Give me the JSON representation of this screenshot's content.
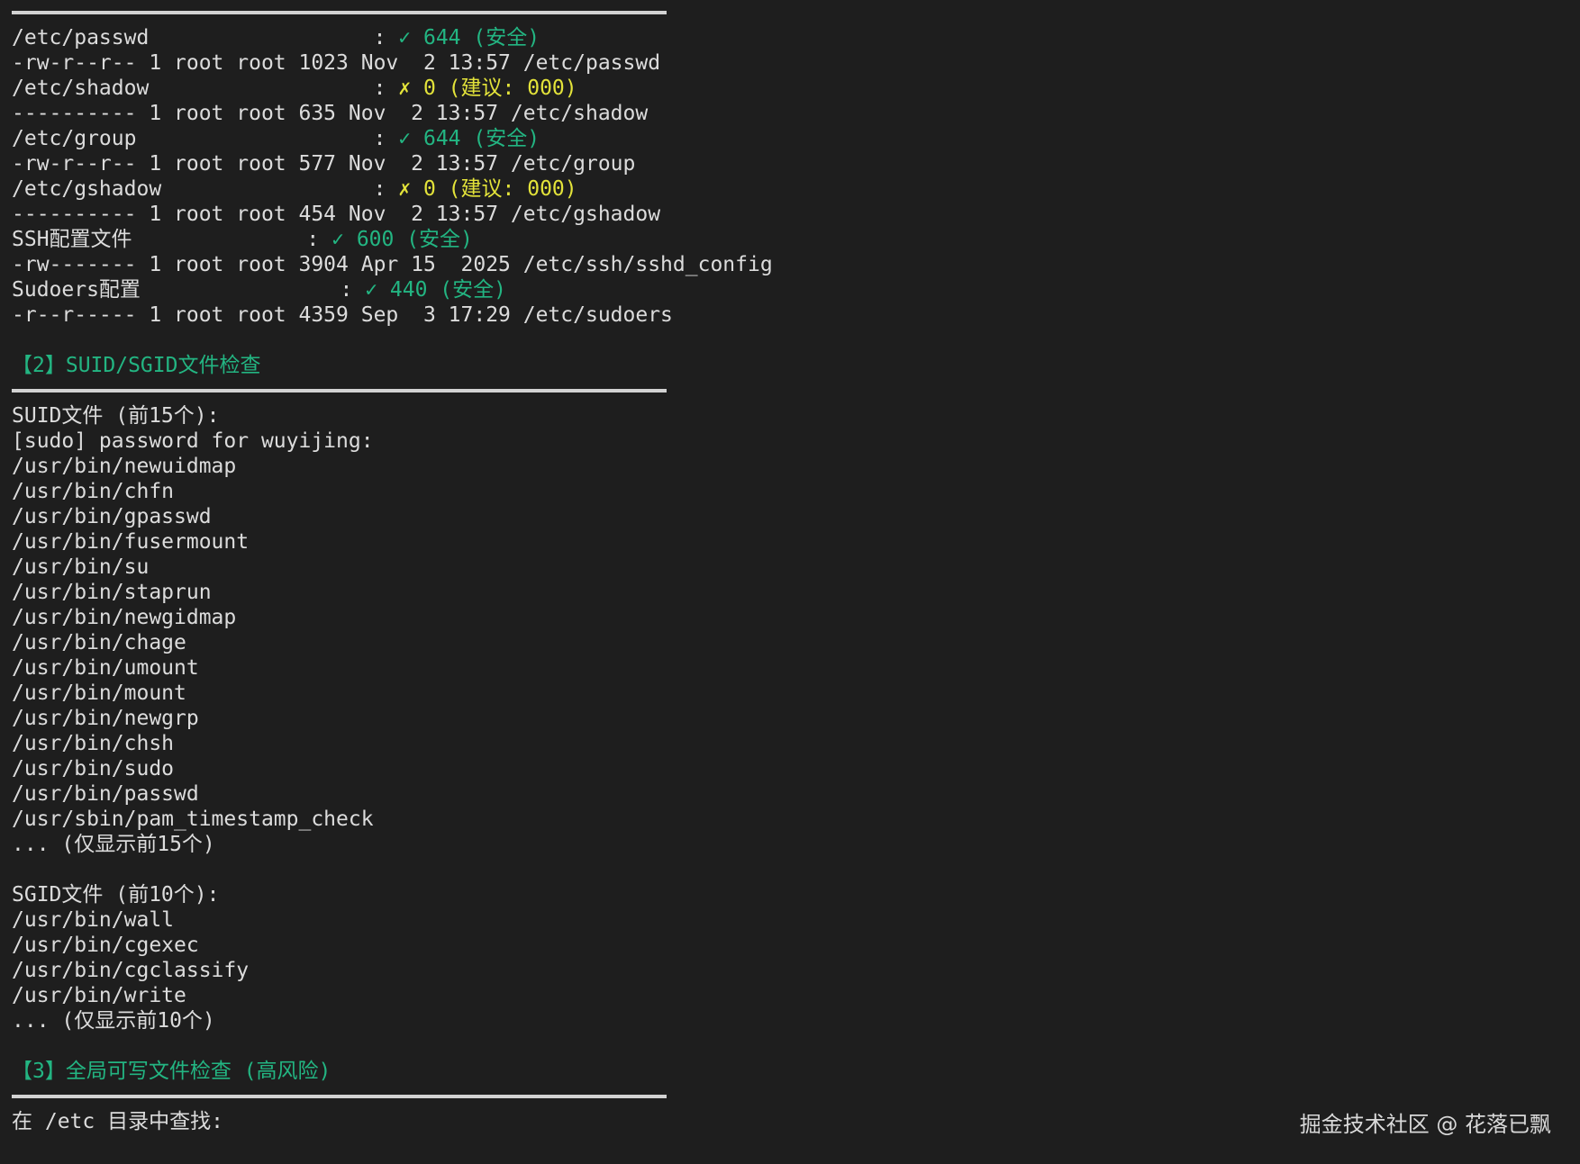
{
  "perm_checks": [
    {
      "label": "/etc/passwd                  ",
      "sep": ": ",
      "mark": "✓",
      "result": " 644 (安全)",
      "status": "ok",
      "ls": "-rw-r--r-- 1 root root 1023 Nov  2 13:57 /etc/passwd"
    },
    {
      "label": "/etc/shadow                  ",
      "sep": ": ",
      "mark": "✗",
      "result": " 0 (建议: 000)",
      "status": "warn",
      "ls": "---------- 1 root root 635 Nov  2 13:57 /etc/shadow"
    },
    {
      "label": "/etc/group                   ",
      "sep": ": ",
      "mark": "✓",
      "result": " 644 (安全)",
      "status": "ok",
      "ls": "-rw-r--r-- 1 root root 577 Nov  2 13:57 /etc/group"
    },
    {
      "label": "/etc/gshadow                 ",
      "sep": ": ",
      "mark": "✗",
      "result": " 0 (建议: 000)",
      "status": "warn",
      "ls": "---------- 1 root root 454 Nov  2 13:57 /etc/gshadow"
    },
    {
      "label": "SSH配置文件              ",
      "sep": ": ",
      "mark": "✓",
      "result": " 600 (安全)",
      "status": "ok",
      "ls": "-rw------- 1 root root 3904 Apr 15  2025 /etc/ssh/sshd_config"
    },
    {
      "label": "Sudoers配置                ",
      "sep": ": ",
      "mark": "✓",
      "result": " 440 (安全)",
      "status": "ok",
      "ls": "-r--r----- 1 root root 4359 Sep  3 17:29 /etc/sudoers"
    }
  ],
  "section2": {
    "heading": "【2】SUID/SGID文件检查",
    "suid_title": "SUID文件 (前15个):",
    "sudo_prompt": "[sudo] password for wuyijing:",
    "suid_files": [
      "/usr/bin/newuidmap",
      "/usr/bin/chfn",
      "/usr/bin/gpasswd",
      "/usr/bin/fusermount",
      "/usr/bin/su",
      "/usr/bin/staprun",
      "/usr/bin/newgidmap",
      "/usr/bin/chage",
      "/usr/bin/umount",
      "/usr/bin/mount",
      "/usr/bin/newgrp",
      "/usr/bin/chsh",
      "/usr/bin/sudo",
      "/usr/bin/passwd",
      "/usr/sbin/pam_timestamp_check"
    ],
    "suid_more": "... (仅显示前15个)",
    "sgid_title": "SGID文件 (前10个):",
    "sgid_files": [
      "/usr/bin/wall",
      "/usr/bin/cgexec",
      "/usr/bin/cgclassify",
      "/usr/bin/write"
    ],
    "sgid_more": "... (仅显示前10个)"
  },
  "section3": {
    "heading": "【3】全局可写文件检查 (高风险)",
    "search_text": "在 /etc 目录中查找:"
  },
  "watermark": "掘金技术社区 @ 花落已飘",
  "colors": {
    "background": "#1e1e1e",
    "text": "#dcdcdc",
    "ok": "#23b582",
    "warn": "#e3e33a",
    "rule": "#d2d2d2"
  }
}
